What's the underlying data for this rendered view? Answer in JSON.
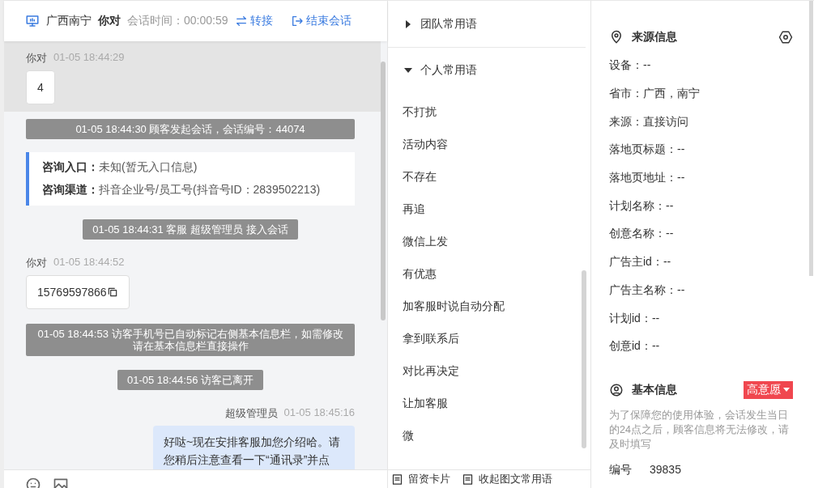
{
  "header": {
    "location": "广西南宁",
    "name": "你对",
    "duration_label": "会话时间：",
    "duration": "00:00:59",
    "transfer": "转接",
    "end": "结束会话"
  },
  "messages": [
    {
      "kind": "customer",
      "sender": "你对",
      "time": "01-05 18:44:29",
      "text": "4",
      "highlighted": true,
      "copyable": false
    },
    {
      "kind": "system",
      "text": "01-05 18:44:30 顾客发起会话，会话编号：44074"
    },
    {
      "kind": "entry",
      "rows": [
        {
          "label": "咨询入口：",
          "value": "未知(暂无入口信息)"
        },
        {
          "label": "咨询渠道：",
          "value": "抖音企业号/员工号(抖音号ID：2839502213)"
        }
      ]
    },
    {
      "kind": "system",
      "text": "01-05 18:44:31 客服 超级管理员 接入会话"
    },
    {
      "kind": "customer",
      "sender": "你对",
      "time": "01-05 18:44:52",
      "text": "15769597866",
      "highlighted": false,
      "copyable": true
    },
    {
      "kind": "system",
      "text": "01-05 18:44:53 访客手机号已自动标记右侧基本信息栏，如需修改请在基本信息栏直接操作"
    },
    {
      "kind": "system",
      "text": "01-05 18:44:56 访客已离开"
    },
    {
      "kind": "agent",
      "sender": "超级管理员",
      "time": "01-05 18:45:16",
      "text": "好哒~现在安排客服加您介绍哈。请您稍后注意查看一下“通讯录”并点"
    }
  ],
  "phrases": [
    {
      "title": "团队常用语",
      "expanded": false
    },
    {
      "title": "个人常用语",
      "expanded": true,
      "items": [
        "不打扰",
        "活动内容",
        "不存在",
        "再追",
        "微信上发",
        "有优惠",
        "加客服时说自动分配",
        "拿到联系后",
        "对比再决定",
        "让加客服",
        "微"
      ]
    }
  ],
  "phrase_toolbar": [
    "留资卡片",
    "收起图文常用语"
  ],
  "source_info": {
    "title": "来源信息",
    "fields": [
      "设备：--",
      "省市：广西，南宁",
      "来源：直接访问",
      "落地页标题：--",
      "落地页地址：--",
      "计划名称：--",
      "创意名称：--",
      "广告主id：--",
      "广告主名称：--",
      "计划id：--",
      "创意id：--"
    ]
  },
  "basic_info": {
    "title": "基本信息",
    "intent_tag": "高意愿",
    "notice": "为了保障您的使用体验，会话发生当日的24点之后，顾客信息将无法修改，请及时填写",
    "fields": [
      {
        "label": "编号",
        "value": "39835"
      }
    ]
  }
}
